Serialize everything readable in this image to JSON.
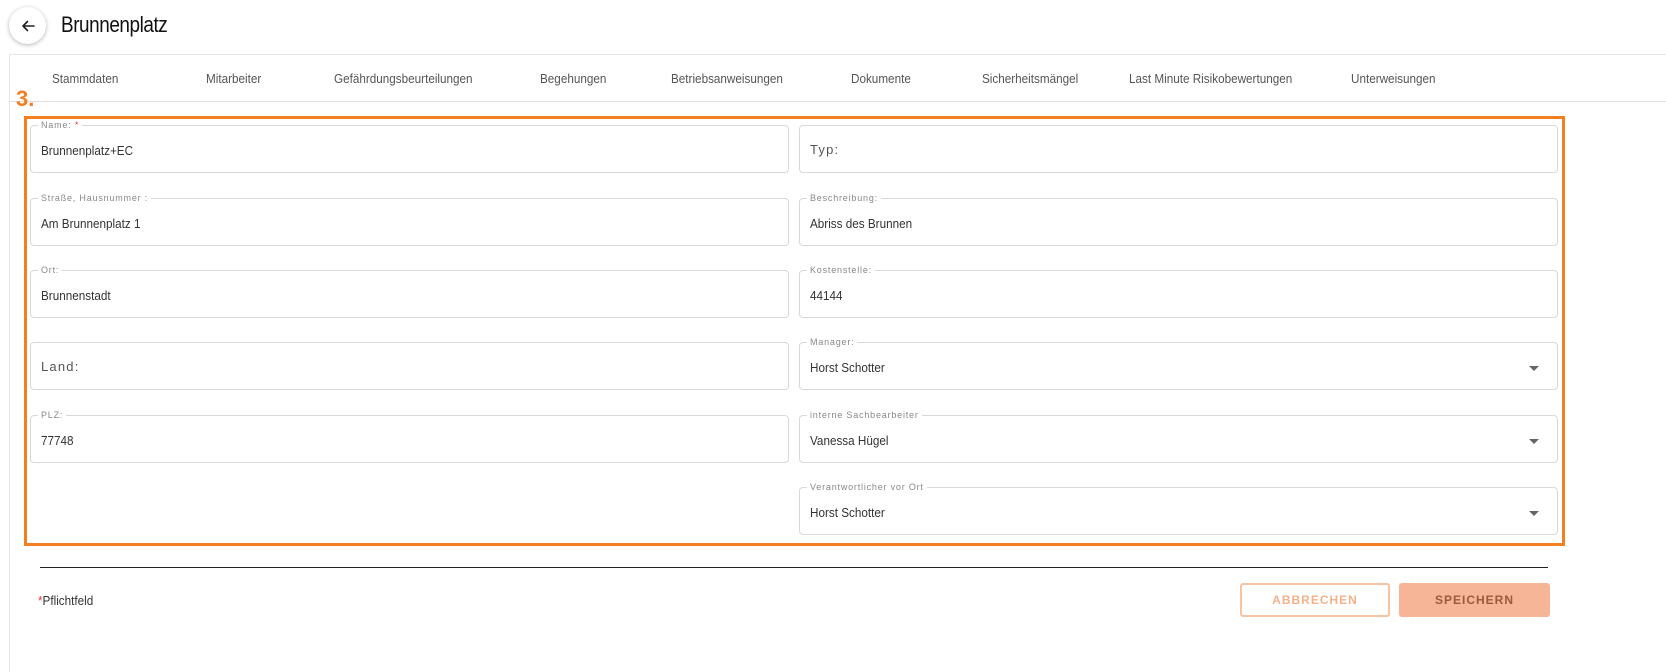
{
  "header": {
    "title": "Brunnenplatz",
    "back_icon": "arrow-left-icon"
  },
  "tabs": [
    {
      "label": "Stammdaten"
    },
    {
      "label": "Mitarbeiter"
    },
    {
      "label": "Gefährdungsbeurteilungen"
    },
    {
      "label": "Begehungen"
    },
    {
      "label": "Betriebsanweisungen"
    },
    {
      "label": "Dokumente"
    },
    {
      "label": "Sicherheitsmängel"
    },
    {
      "label": "Last Minute Risikobewertungen"
    },
    {
      "label": "Unterweisungen"
    }
  ],
  "annotation": {
    "step_label": "3.",
    "color": "#f47f20"
  },
  "form": {
    "name": {
      "label": "Name:",
      "required_mark": "*",
      "value": "Brunnenplatz+EC"
    },
    "typ": {
      "placeholder": "Typ:"
    },
    "strasse": {
      "label": "Straße, Hausnummer :",
      "value": "Am Brunnenplatz 1"
    },
    "beschreibung": {
      "label": "Beschreibung:",
      "value": "Abriss des Brunnen"
    },
    "ort": {
      "label": "Ort:",
      "value": "Brunnenstadt"
    },
    "kostenstelle": {
      "label": "Kostenstelle:",
      "value": "44144"
    },
    "land": {
      "placeholder": "Land:"
    },
    "manager": {
      "label": "Manager:",
      "value": "Horst Schotter"
    },
    "plz": {
      "label": "PLZ:",
      "value": "77748"
    },
    "sachbearbeiter": {
      "label": "interne Sachbearbeiter",
      "value": "Vanessa Hügel"
    },
    "verantwortlicher": {
      "label": "Verantwortlicher vor Ort",
      "value": "Horst Schotter"
    }
  },
  "footer": {
    "required_star": "*",
    "required_text": "Pflichtfeld",
    "cancel_label": "ABBRECHEN",
    "save_label": "SPEICHERN"
  },
  "colors": {
    "accent": "#f47f20",
    "required": "#e53935",
    "save_bg": "#f6b596"
  }
}
